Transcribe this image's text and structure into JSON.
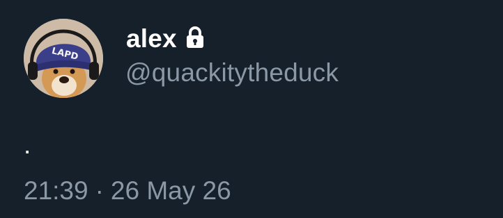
{
  "author": {
    "display_name": "alex",
    "handle": "@quackitytheduck",
    "protected_icon": "lock-icon",
    "avatar_beanie_text": "LAPD"
  },
  "tweet": {
    "text": "."
  },
  "meta": {
    "time": "21:39",
    "separator": "·",
    "date": "26 May 26"
  },
  "colors": {
    "background": "#15202b",
    "primary_text": "#ffffff",
    "secondary_text": "#8b98a5"
  }
}
